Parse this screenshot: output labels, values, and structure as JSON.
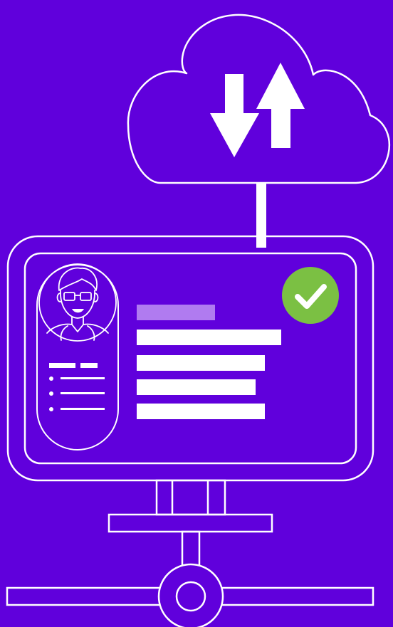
{
  "colors": {
    "background": "#6000DC",
    "line": "#FFFFFF",
    "bar_highlight": "#B07BF0",
    "check_badge": "#7BC043"
  },
  "icons": {
    "cloud": "cloud-icon",
    "sync": "upload-download-arrows-icon",
    "doctor": "doctor-avatar-icon",
    "check": "check-circle-icon",
    "network": "network-node-icon"
  },
  "record": {
    "title_bar": "",
    "field_bars": [
      "",
      "",
      "",
      ""
    ],
    "sidebar_list_items": [
      "",
      "",
      ""
    ]
  }
}
